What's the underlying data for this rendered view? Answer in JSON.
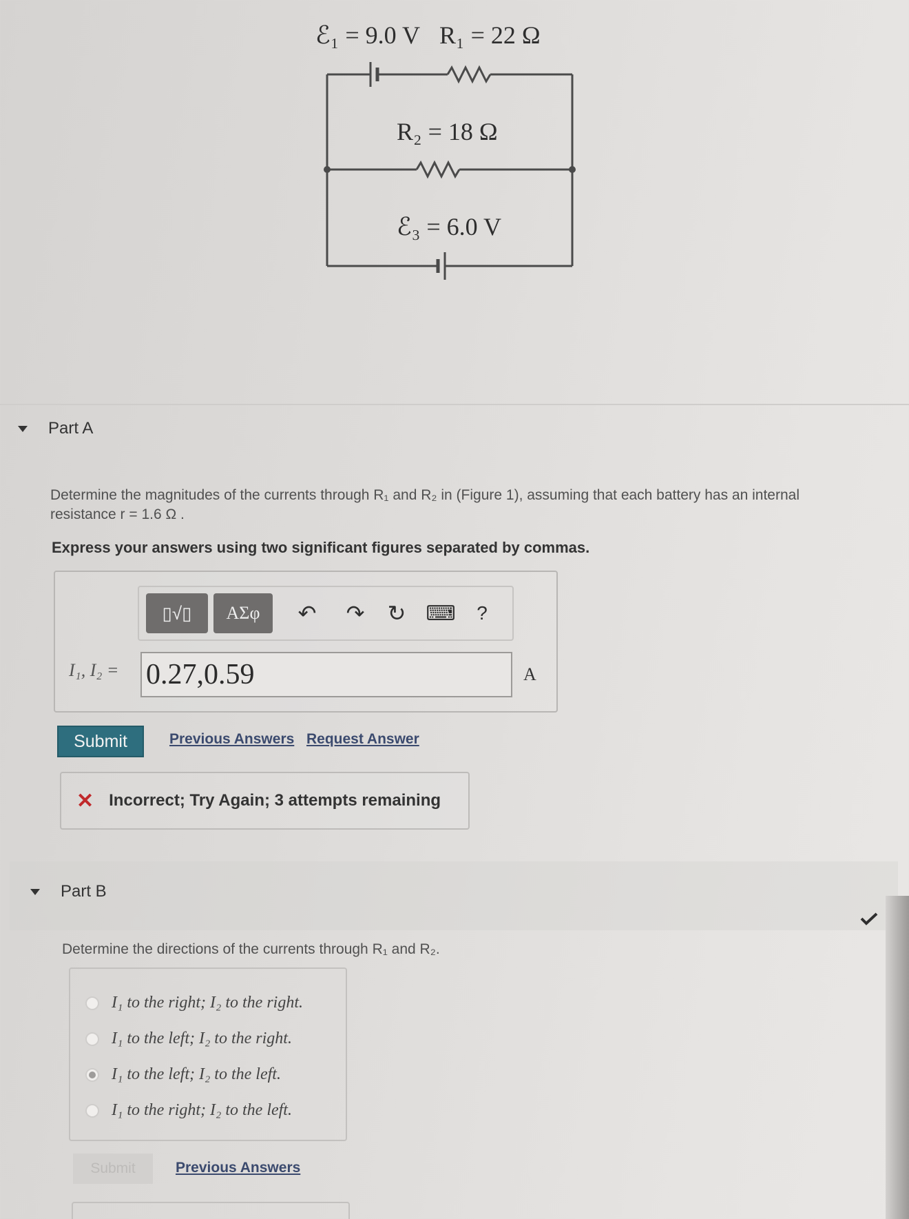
{
  "figure": {
    "emf1": "ℰ₁ = 9.0 V",
    "r1": "R₁ = 22 Ω",
    "r2": "R₂ = 18 Ω",
    "emf3": "ℰ₃ = 6.0 V"
  },
  "partA": {
    "title": "Part A",
    "prompt_line1": "Determine the magnitudes of the currents through R₁ and R₂ in (Figure 1), assuming that each battery has an internal",
    "prompt_line2": "resistance r = 1.6 Ω .",
    "instruction": "Express your answers using two significant figures separated by commas.",
    "toolbar": {
      "templates_label": "▯√▯",
      "symbols_label": "ΑΣφ",
      "undo": "↶",
      "redo": "↷",
      "reset": "↻",
      "keyboard": "⌨",
      "help": "?"
    },
    "input_label": "I₁, I₂ =",
    "input_value": "0.27,0.59",
    "unit": "A",
    "submit_label": "Submit",
    "previous_answers": "Previous Answers",
    "request_answer": "Request Answer",
    "feedback": "Incorrect; Try Again; 3 attempts remaining"
  },
  "partB": {
    "title": "Part B",
    "prompt": "Determine the directions of the currents through R₁ and R₂.",
    "options": [
      {
        "label": "I₁ to the right; I₂ to the right.",
        "selected": false
      },
      {
        "label": "I₁ to the left; I₂ to the right.",
        "selected": false
      },
      {
        "label": "I₁ to the left; I₂ to the left.",
        "selected": true
      },
      {
        "label": "I₁ to the right; I₂ to the left.",
        "selected": false
      }
    ],
    "submit_label": "Submit",
    "previous_answers": "Previous Answers"
  },
  "icons": {
    "caret": "caret-down-icon",
    "x": "x-mark-icon",
    "check": "checkmark-icon"
  },
  "colors": {
    "submit": "#2e6e7e",
    "incorrect": "#c0282a",
    "link": "#3b4a6e"
  }
}
